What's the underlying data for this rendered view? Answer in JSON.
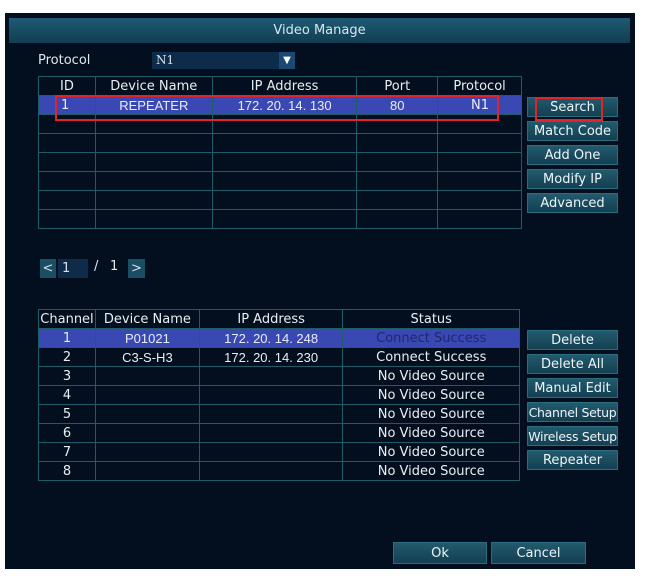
{
  "title": "Video Manage",
  "protocol": {
    "label": "Protocol",
    "value": "N1"
  },
  "search_table": {
    "headers": [
      "ID",
      "Device Name",
      "IP Address",
      "Port",
      "Protocol"
    ],
    "rows": [
      [
        "1",
        "REPEATER",
        "172. 20. 14. 130",
        "80",
        "N1"
      ]
    ]
  },
  "pagination": {
    "current": "1",
    "separator": "/",
    "total": "1",
    "prev": "<",
    "next": ">"
  },
  "top_buttons": [
    "Search",
    "Match Code",
    "Add One",
    "Modify IP",
    "Advanced"
  ],
  "channel_table": {
    "headers": [
      "Channel",
      "Device Name",
      "IP Address",
      "Status"
    ],
    "rows": [
      [
        "1",
        "P01021",
        "172. 20. 14. 248",
        "Connect Success"
      ],
      [
        "2",
        "C3-S-H3",
        "172. 20. 14. 230",
        "Connect Success"
      ],
      [
        "3",
        "",
        "",
        "No Video Source"
      ],
      [
        "4",
        "",
        "",
        "No Video Source"
      ],
      [
        "5",
        "",
        "",
        "No Video Source"
      ],
      [
        "6",
        "",
        "",
        "No Video Source"
      ],
      [
        "7",
        "",
        "",
        "No Video Source"
      ],
      [
        "8",
        "",
        "",
        "No Video Source"
      ]
    ]
  },
  "bottom_buttons": [
    "Delete",
    "Delete All",
    "Manual Edit",
    "Channel Setup",
    "Wireless Setup",
    "Repeater"
  ],
  "ok": "Ok",
  "cancel": "Cancel",
  "colors": {
    "highlight": "#3a48b4",
    "grid": "#1e5d68",
    "annotation": "#e0242a"
  }
}
